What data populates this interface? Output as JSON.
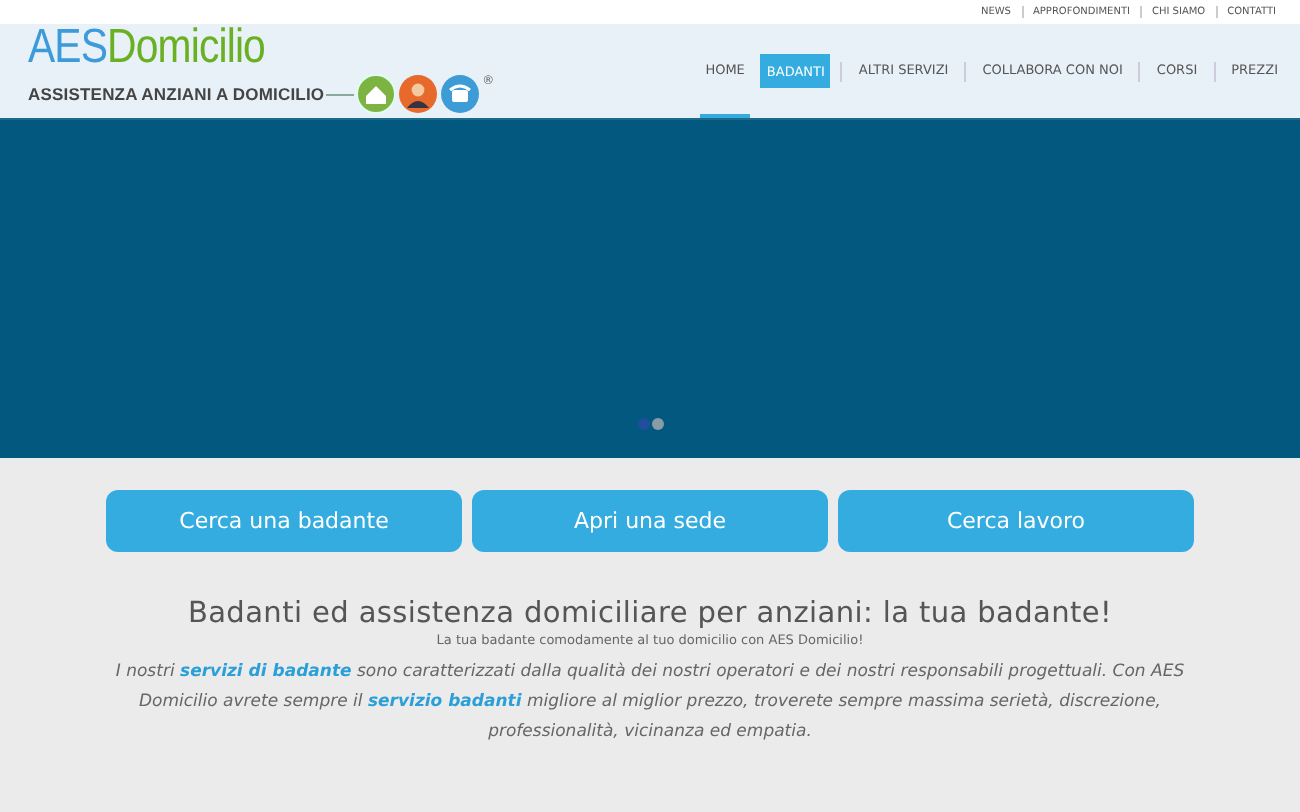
{
  "top_links": [
    "NEWS",
    "APPROFONDIMENTI",
    "CHI SIAMO",
    "CONTATTI"
  ],
  "logo": {
    "part_1": "AES",
    "part_2": "Domicilio",
    "tagline": "ASSISTENZA ANZIANI A DOMICILIO",
    "mark": "®"
  },
  "nav": [
    {
      "label": "HOME",
      "selected": false,
      "underlined": true
    },
    {
      "label": "BADANTI",
      "selected": true,
      "underlined": false
    },
    {
      "label": "ALTRI SERVIZI",
      "selected": false,
      "underlined": false
    },
    {
      "label": "COLLABORA CON NOI",
      "selected": false,
      "underlined": false
    },
    {
      "label": "CORSI",
      "selected": false,
      "underlined": false
    },
    {
      "label": "PREZZI",
      "selected": false,
      "underlined": false
    }
  ],
  "slider_dots": [
    {
      "selected": true
    },
    {
      "selected": false
    }
  ],
  "actions": [
    "Cerca una badante",
    "Apri una sede",
    "Cerca lavoro"
  ],
  "heading": "Badanti ed assistenza domiciliare per anziani: la tua badante!",
  "subheading": "La tua badante comodamente al tuo domicilio con AES Domicilio!",
  "paragraph": [
    {
      "kind": "text",
      "text": "I nostri "
    },
    {
      "kind": "link",
      "text": "servizi di badante"
    },
    {
      "kind": "text",
      "text": " sono caratterizzati dalla qualità dei nostri operatori e dei nostri responsabili progettuali. Con AES Domicilio avrete sempre il "
    },
    {
      "kind": "link",
      "text": "servizio badanti"
    },
    {
      "kind": "text",
      "text": " migliore al miglior prezzo, troverete sempre massima serietà, discrezione, professionalità, vicinanza ed empatia."
    }
  ]
}
